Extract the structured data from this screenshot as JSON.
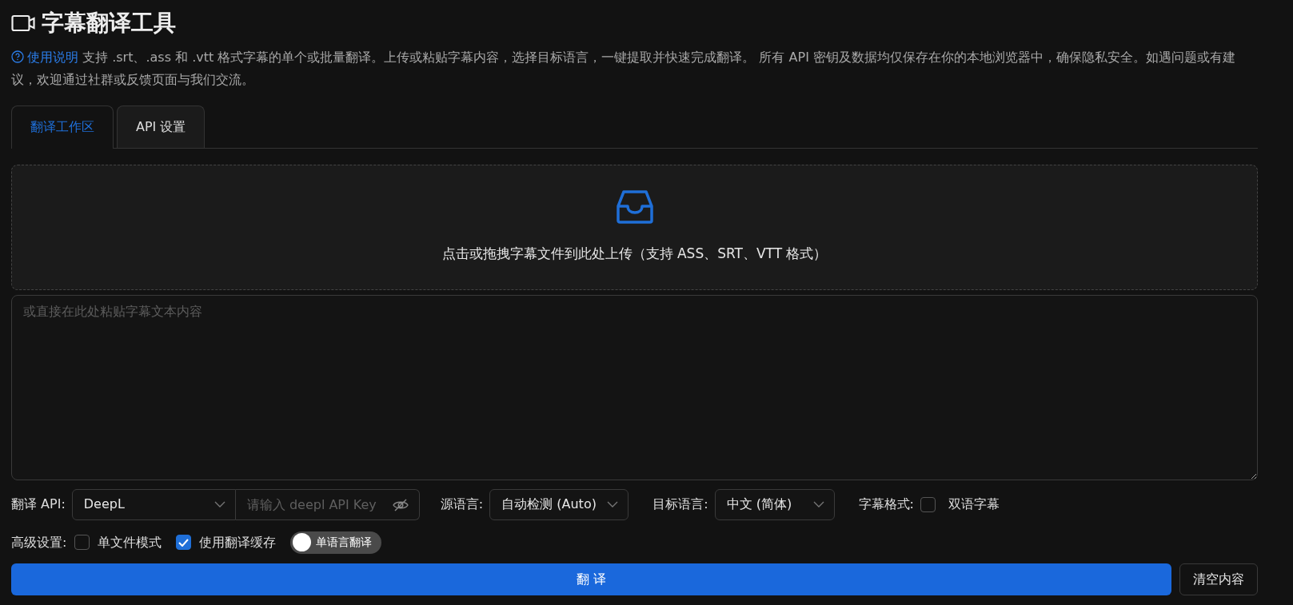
{
  "title": "字幕翻译工具",
  "intro": {
    "link": "使用说明",
    "text": "支持 .srt、.ass 和 .vtt 格式字幕的单个或批量翻译。上传或粘贴字幕内容，选择目标语言，一键提取并快速完成翻译。 所有 API 密钥及数据均仅保存在你的本地浏览器中，确保隐私安全。如遇问题或有建议，欢迎通过社群或反馈页面与我们交流。"
  },
  "tabs": [
    {
      "label": "翻译工作区",
      "selected": true
    },
    {
      "label": "API 设置",
      "selected": false
    }
  ],
  "upload": {
    "text": "点击或拖拽字幕文件到此处上传（支持 ASS、SRT、VTT 格式）"
  },
  "paste": {
    "placeholder": "或直接在此处粘贴字幕文本内容"
  },
  "options": {
    "api_label": "翻译 API:",
    "api_value": "DeepL",
    "key_placeholder": "请输入 deepl API Key",
    "source_label": "源语言:",
    "source_value": "自动检测 (Auto)",
    "target_label": "目标语言:",
    "target_value": "中文 (简体)",
    "format_label": "字幕格式:",
    "bilingual": {
      "label": "双语字幕",
      "checked": false
    }
  },
  "advanced": {
    "label": "高级设置:",
    "checks": [
      {
        "label": "单文件模式",
        "checked": false
      },
      {
        "label": "使用翻译缓存",
        "checked": true
      }
    ],
    "switch": {
      "label": "单语言翻译",
      "on": false
    }
  },
  "buttons": {
    "translate": "翻 译",
    "clear": "清空内容"
  }
}
